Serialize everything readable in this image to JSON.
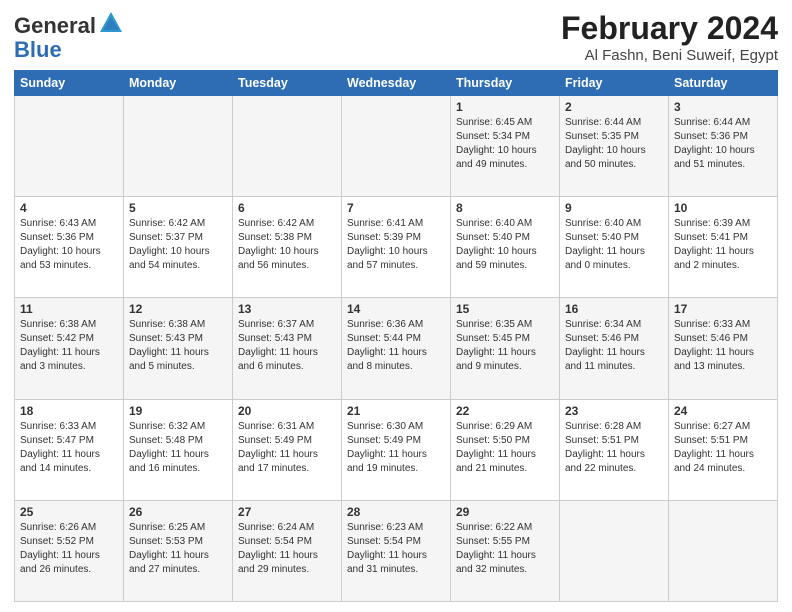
{
  "header": {
    "logo_general": "General",
    "logo_blue": "Blue",
    "title": "February 2024",
    "subtitle": "Al Fashn, Beni Suweif, Egypt"
  },
  "days_of_week": [
    "Sunday",
    "Monday",
    "Tuesday",
    "Wednesday",
    "Thursday",
    "Friday",
    "Saturday"
  ],
  "weeks": [
    [
      {
        "day": "",
        "info": ""
      },
      {
        "day": "",
        "info": ""
      },
      {
        "day": "",
        "info": ""
      },
      {
        "day": "",
        "info": ""
      },
      {
        "day": "1",
        "info": "Sunrise: 6:45 AM\nSunset: 5:34 PM\nDaylight: 10 hours and 49 minutes."
      },
      {
        "day": "2",
        "info": "Sunrise: 6:44 AM\nSunset: 5:35 PM\nDaylight: 10 hours and 50 minutes."
      },
      {
        "day": "3",
        "info": "Sunrise: 6:44 AM\nSunset: 5:36 PM\nDaylight: 10 hours and 51 minutes."
      }
    ],
    [
      {
        "day": "4",
        "info": "Sunrise: 6:43 AM\nSunset: 5:36 PM\nDaylight: 10 hours and 53 minutes."
      },
      {
        "day": "5",
        "info": "Sunrise: 6:42 AM\nSunset: 5:37 PM\nDaylight: 10 hours and 54 minutes."
      },
      {
        "day": "6",
        "info": "Sunrise: 6:42 AM\nSunset: 5:38 PM\nDaylight: 10 hours and 56 minutes."
      },
      {
        "day": "7",
        "info": "Sunrise: 6:41 AM\nSunset: 5:39 PM\nDaylight: 10 hours and 57 minutes."
      },
      {
        "day": "8",
        "info": "Sunrise: 6:40 AM\nSunset: 5:40 PM\nDaylight: 10 hours and 59 minutes."
      },
      {
        "day": "9",
        "info": "Sunrise: 6:40 AM\nSunset: 5:40 PM\nDaylight: 11 hours and 0 minutes."
      },
      {
        "day": "10",
        "info": "Sunrise: 6:39 AM\nSunset: 5:41 PM\nDaylight: 11 hours and 2 minutes."
      }
    ],
    [
      {
        "day": "11",
        "info": "Sunrise: 6:38 AM\nSunset: 5:42 PM\nDaylight: 11 hours and 3 minutes."
      },
      {
        "day": "12",
        "info": "Sunrise: 6:38 AM\nSunset: 5:43 PM\nDaylight: 11 hours and 5 minutes."
      },
      {
        "day": "13",
        "info": "Sunrise: 6:37 AM\nSunset: 5:43 PM\nDaylight: 11 hours and 6 minutes."
      },
      {
        "day": "14",
        "info": "Sunrise: 6:36 AM\nSunset: 5:44 PM\nDaylight: 11 hours and 8 minutes."
      },
      {
        "day": "15",
        "info": "Sunrise: 6:35 AM\nSunset: 5:45 PM\nDaylight: 11 hours and 9 minutes."
      },
      {
        "day": "16",
        "info": "Sunrise: 6:34 AM\nSunset: 5:46 PM\nDaylight: 11 hours and 11 minutes."
      },
      {
        "day": "17",
        "info": "Sunrise: 6:33 AM\nSunset: 5:46 PM\nDaylight: 11 hours and 13 minutes."
      }
    ],
    [
      {
        "day": "18",
        "info": "Sunrise: 6:33 AM\nSunset: 5:47 PM\nDaylight: 11 hours and 14 minutes."
      },
      {
        "day": "19",
        "info": "Sunrise: 6:32 AM\nSunset: 5:48 PM\nDaylight: 11 hours and 16 minutes."
      },
      {
        "day": "20",
        "info": "Sunrise: 6:31 AM\nSunset: 5:49 PM\nDaylight: 11 hours and 17 minutes."
      },
      {
        "day": "21",
        "info": "Sunrise: 6:30 AM\nSunset: 5:49 PM\nDaylight: 11 hours and 19 minutes."
      },
      {
        "day": "22",
        "info": "Sunrise: 6:29 AM\nSunset: 5:50 PM\nDaylight: 11 hours and 21 minutes."
      },
      {
        "day": "23",
        "info": "Sunrise: 6:28 AM\nSunset: 5:51 PM\nDaylight: 11 hours and 22 minutes."
      },
      {
        "day": "24",
        "info": "Sunrise: 6:27 AM\nSunset: 5:51 PM\nDaylight: 11 hours and 24 minutes."
      }
    ],
    [
      {
        "day": "25",
        "info": "Sunrise: 6:26 AM\nSunset: 5:52 PM\nDaylight: 11 hours and 26 minutes."
      },
      {
        "day": "26",
        "info": "Sunrise: 6:25 AM\nSunset: 5:53 PM\nDaylight: 11 hours and 27 minutes."
      },
      {
        "day": "27",
        "info": "Sunrise: 6:24 AM\nSunset: 5:54 PM\nDaylight: 11 hours and 29 minutes."
      },
      {
        "day": "28",
        "info": "Sunrise: 6:23 AM\nSunset: 5:54 PM\nDaylight: 11 hours and 31 minutes."
      },
      {
        "day": "29",
        "info": "Sunrise: 6:22 AM\nSunset: 5:55 PM\nDaylight: 11 hours and 32 minutes."
      },
      {
        "day": "",
        "info": ""
      },
      {
        "day": "",
        "info": ""
      }
    ]
  ]
}
